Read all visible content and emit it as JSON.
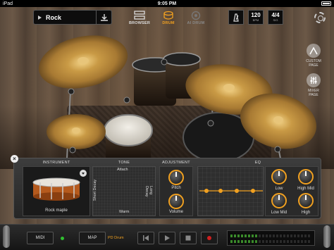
{
  "status_bar": {
    "carrier": "iPad",
    "time": "9:05 PM",
    "battery": ""
  },
  "song": {
    "name": "Rock"
  },
  "nav": {
    "browser": "BROWSER",
    "drum": "DRUM",
    "ai_drum": "AI DRUM"
  },
  "tempo": {
    "bpm": "120",
    "bpm_unit": "BPM",
    "signature": "4/4",
    "signature_unit": "SIG"
  },
  "side": {
    "custom_page": "CUSTOM PAGE",
    "mixer_page": "MIXER PAGE"
  },
  "panel": {
    "instrument": {
      "title": "INSTRUMENT",
      "name": "Rock maple"
    },
    "tone": {
      "title": "TONE",
      "attach": "Attach",
      "warm": "Warm",
      "short_decay": "Short Decay",
      "long_decay": "Long Decay"
    },
    "adjustment": {
      "title": "ADJUSTMENT",
      "pitch": "Pitch",
      "volume": "Volume"
    },
    "eq": {
      "title": "EQ",
      "low": "Low",
      "high_mid": "High Mid",
      "low_mid": "Low Mid",
      "high": "High"
    }
  },
  "bottom": {
    "midi": "MIDI",
    "map": "MAP",
    "pd_drum": "PD Drum"
  },
  "colors": {
    "accent": "#f0a020",
    "record": "#d02020",
    "midi_led": "#30c030"
  },
  "icons": [
    "play-icon",
    "download-icon",
    "browser-icon",
    "drum-icon",
    "ai-drum-icon",
    "metronome-icon",
    "gear-icon",
    "custom-page-icon",
    "mixer-page-icon",
    "close-icon",
    "chevron-down-icon",
    "previous-icon",
    "play-icon",
    "stop-icon",
    "record-icon"
  ]
}
